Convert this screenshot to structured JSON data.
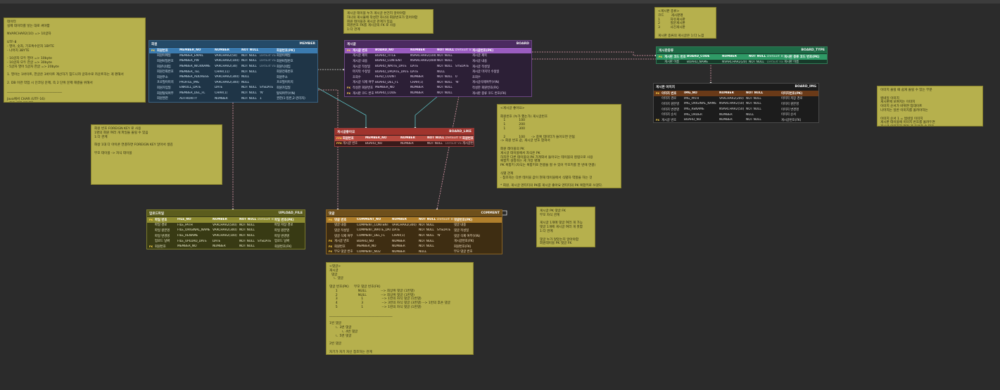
{
  "notes": [
    {
      "id": "note-data-types",
      "lines": [
        "데이터",
        "실제 데이터를 넣는 대로 써야함",
        "",
        "NVARCHAR2(10) => 10글자",
        "",
        "UTF-8",
        "- 영어, 숫자, 기호특수문자 1BYTE",
        "- 나머지 3BYTE",
        "",
        "- 10글자 모두 영어 => 10byte",
        "- 10글자 모두 한글 => 30byte",
        "- 5글자 영어 5글자 한글 => 20byte",
        "",
        "1. 영어는 1바이트, 한글은 3바이트 계산하기 힘드니까 글자수로 카운트하는 게 편해서",
        "",
        "2. DB 이관 작업 시 인코딩 문제, 즉 2 단위 문제 해결을 위해서",
        "",
        "__________________________________",
        "",
        "Java에서 CHAR (UTF-16)",
        "- 모든 글자 2BYTE"
      ]
    },
    {
      "id": "note-fk",
      "lines": [
        "회원 번호 FOREIGN KEY 로 사용",
        "1명의 회원 여러 개 파일을 올릴 수 있음",
        "1:다 관계",
        "",
        "화살 1대 다 아이콘 연결하면 FOREIGN KEY 알아서 생김",
        "",
        "부모 테이블 -> 자식 테이블"
      ]
    },
    {
      "id": "note-board-rel",
      "lines": [
        "게시글 테이블 누가 게시글 쓴건지 알아야함",
        "하나의 게시물에 작성한 하나의 회원번호가 있어야함",
        "회원 테이블과 게시글 관계가 있음",
        "회원번호 FK를 게시글의 FK 로 사용",
        "1:다 관계"
      ]
    },
    {
      "id": "note-board-type",
      "lines": [
        "<게시판 종류>",
        "코드       게시판명",
        "1          자유게시판",
        "2          질문게시판",
        "3          사진게시판",
        "",
        "게시판 종류의 게시글은 1:다 느낌"
      ]
    },
    {
      "id": "note-like",
      "lines": [
        "<게시글 좋아요>",
        "",
        "회원번호 (누가 했는가) 게시글번호",
        "   1             100",
        "   1             200",
        "   1             300",
        "",
        "   2             100      -> 중복 데이터가 들어오면 안됨",
        "-> 회원 번호 값, 게시글 번호 합쳐서",
        "",
        "회원 레이블의 PK",
        "게시글 테이블에서 자식은 PK",
        "하지만 다른 테이블의 PK 가져와서 들어오는 테이블의 컬럼으로 사용",
        "복합키 설정하는 게 가장 명쾌",
        "PK 복합키 (자식는 복합키로 연결을 할 수 있어 부모키를 한 번에 연결)",
        "",
        "식별 관계",
        "- 참조하는 다른 테이블 값이 현재 테이블에서 식별자 역할을 하는 것",
        "",
        "* 회원, 게시글 엔티티의 PK를 게시글 좋아요 엔티티의 PK 복합키로 쓰겠다.",
        "-> (PFK) 식별관계(회)선 업"
      ]
    },
    {
      "id": "note-img",
      "lines": [
        "이미지 올릴 때 쉽게 올릴 수 있는 부분",
        "",
        "썸네일 이미지",
        "게시판에 보여지는 이미지",
        "이미지 순서가 바뀌면 업데이트",
        "나머지는 일반 이미지를 올려야하는",
        "",
        "이미지 순서 1 = 썸네일 이미지",
        "게시판 테이블에 이미지 번호를 올려두면",
        "게시글 이미지가 여러 개 들어갈 수 있음",
        "",
        "게시판 이미지가 게시판 내에 여러 개 가능"
      ]
    },
    {
      "id": "note-comment-fk",
      "lines": [
        "게시글 PK 댓글 FK",
        "부모 자식 관계",
        "",
        "게시글 1개에 댓글 여러 개 가능",
        "댓글 1개에 게시글 여러 개 못함",
        "1:다 관계",
        "",
        "댓글 누가 달았는지 알아야함",
        "회원테이블 PK 댓글 FK"
      ]
    },
    {
      "id": "note-comment-tree",
      "lines": [
        "<댓글>",
        "게시글",
        "  댓글",
        "    ㄴ 댓글",
        "",
        "댓글 번호(PK)     부모 댓글 번호(FK)",
        "      1                    NULL              --> 최상위 댓글 (1번댓)",
        "      2                    NULL              --> 최상위 댓글 (1번댓)",
        "      3                       1                  --> 1번의 자식 댓글 (1번댓)",
        "      4                       3                  --> 3번의 자식 댓글 (3번댓) --> 1번의 후손 댓글",
        "      5                       1                  --> 1번의 자식 댓글 (1번댓)",
        "",
        "_______________________________________",
        "",
        "1번 댓글",
        "      ㄴ 3번 댓글",
        "            ㄴ 4번 댓글",
        "      ㄴ 5번 댓글",
        "",
        "2번 댓글",
        "",
        "자기가 자기 자신 참조하는 관계"
      ]
    }
  ],
  "entities": [
    {
      "id": "member",
      "korean": "회원",
      "english": "MEMBER",
      "rows": [
        [
          "PK",
          "회원번호",
          "MEMBER_NO",
          "NUMBER",
          "NOT NULL",
          "",
          "회원번호(PK)"
        ],
        [
          "",
          "회원이메일",
          "MEMBER_EMAIL",
          "VARCHAR2(50)",
          "NOT NULL",
          "Default Value",
          "회원이메일"
        ],
        [
          "",
          "회원비밀번호",
          "MEMBER_PW",
          "VARCHAR2(100)",
          "NOT NULL",
          "Default Value",
          "회원비밀번호"
        ],
        [
          "",
          "회원닉네임",
          "MEMBER_NICKNAME",
          "VARCHAR2(30)",
          "NOT NULL",
          "Default Value",
          "회원닉네임"
        ],
        [
          "",
          "회원전화번호",
          "MEMBER_TEL",
          "CHAR(11)",
          "NOT NULL",
          "",
          "회원전화번호"
        ],
        [
          "",
          "회원주소",
          "MEMBER_ADDRESS",
          "VARCHAR2(300)",
          "NULL",
          "",
          "회원주소"
        ],
        [
          "",
          "프로필이미지",
          "PROFILE_IMG",
          "VARCHAR2(300)",
          "NULL",
          "",
          "프로필이미지"
        ],
        [
          "",
          "회원가입일",
          "ENROLL_DATE",
          "DATE",
          "NOT NULL",
          "SYSDATE",
          "회원가입일"
        ],
        [
          "",
          "회원탈퇴여부",
          "MEMBER_DEL_FL",
          "CHAR(1)",
          "NOT NULL",
          "'N'",
          "탈퇴여부(Y/N)"
        ],
        [
          "",
          "회원권한",
          "AUTHORITY",
          "NUMBER",
          "NOT NULL",
          "1",
          "권한(1:일반,2:관리자)"
        ]
      ]
    },
    {
      "id": "board",
      "korean": "게시글",
      "english": "BOARD",
      "rows": [
        [
          "PK",
          "게시글 번호",
          "BOARD_NO",
          "NUMBER",
          "NOT NULL",
          "Default Value",
          "게시글번호(PK)"
        ],
        [
          "",
          "게시글 제목",
          "BOARD_TITLE",
          "NVARCHAR2(100)",
          "NOT NULL",
          "",
          "게시글 제목"
        ],
        [
          "",
          "게시글 내용",
          "BOARD_CONTENT",
          "NVARCHAR2(4000)",
          "NOT NULL",
          "",
          "게시글 내용"
        ],
        [
          "",
          "게시글 작성일",
          "BOARD_WRITE_DATE",
          "DATE",
          "NOT NULL",
          "SYSDATE",
          "게시글 작성일"
        ],
        [
          "",
          "마지막 수정일",
          "BOARD_UPDATE_DATE",
          "DATE",
          "NULL",
          "",
          "게시글 마지막 수정일"
        ],
        [
          "",
          "조회수",
          "READ_COUNT",
          "NUMBER",
          "NOT NULL",
          "0",
          "조회수"
        ],
        [
          "",
          "게시글 삭제 여부",
          "BOARD_DEL_FL",
          "CHAR(1)",
          "NOT NULL",
          "'N'",
          "게시글삭제여부(Y/N)"
        ],
        [
          "FK",
          "작성한 회원번호",
          "MEMBER_NO",
          "NUMBER",
          "NOT NULL",
          "",
          "작성한 회원번호(FK)"
        ],
        [
          "FK",
          "게시판 코드 번호",
          "BOARD_CODE",
          "NUMBER",
          "NOT NULL",
          "",
          "게시판 종류 코드 번호(FK)"
        ]
      ]
    },
    {
      "id": "board-type",
      "korean": "게시판종류",
      "english": "BOARD_TYPE",
      "rows": [
        [
          "PK",
          "게시판 코드 번호",
          "BOARD_CODE",
          "NUMBER",
          "NOT NULL",
          "Default Value",
          "게시판 종류 코드 번호(PK)"
        ],
        [
          "",
          "게시판 이름",
          "BOARD_NAME",
          "NVARCHAR2(20)",
          "NOT NULL",
          "Default Value",
          "게시판 이름"
        ]
      ]
    },
    {
      "id": "board-img",
      "korean": "게시판 이미지",
      "english": "BOARD_IMG",
      "rows": [
        [
          "PK",
          "이미지 번호",
          "IMG_NO",
          "NUMBER",
          "NOT NULL",
          "",
          "이미지번호(PK)"
        ],
        [
          "",
          "이미지 경로",
          "IMG_PATH",
          "VARCHAR2(200)",
          "NOT NULL",
          "",
          "이미지 저장 경로"
        ],
        [
          "",
          "이미지 원본명",
          "IMG_ORIGINAL_NAME",
          "NVARCHAR2(50)",
          "NOT NULL",
          "",
          "이미지 원본명"
        ],
        [
          "",
          "이미지 변경명",
          "IMG_RENAME",
          "NVARCHAR2(50)",
          "NOT NULL",
          "",
          "이미지 변경명"
        ],
        [
          "",
          "이미지 순서",
          "IMG_ORDER",
          "NUMBER",
          "NULL",
          "",
          "이미지 순서"
        ],
        [
          "FK",
          "게시글 번호",
          "BOARD_NO",
          "NUMBER",
          "NOT NULL",
          "",
          "게시글번호(FK)"
        ]
      ]
    },
    {
      "id": "board-like",
      "korean": "게시글좋아요",
      "english": "BOARD_LIKE",
      "rows": [
        [
          "PFK",
          "회원번호",
          "MEMBER_NO",
          "NUMBER",
          "NOT NULL",
          "Default Value",
          "회원번호(PFK)"
        ],
        [
          "PFK",
          "게시글 번호",
          "BOARD_NO",
          "NUMBER",
          "NOT NULL",
          "Default Value",
          "게시글번호(PFK)"
        ]
      ]
    },
    {
      "id": "upload-file",
      "korean": "업로드파일",
      "english": "UPLOAD_FILE",
      "rows": [
        [
          "PK",
          "파일 번호",
          "FILE_NO",
          "NUMBER",
          "NOT NULL",
          "Default Value",
          "파일 번호(PK)"
        ],
        [
          "",
          "파일 경로",
          "FILE_PATH",
          "VARCHAR2(500)",
          "NOT NULL",
          "",
          "파일 저장 경로"
        ],
        [
          "",
          "파일 원본명",
          "FILE_ORIGINAL_NAME",
          "VARCHAR2(300)",
          "NOT NULL",
          "",
          "파일 원본명"
        ],
        [
          "",
          "파일 변경명",
          "FILE_RENAME",
          "VARCHAR2(100)",
          "NOT NULL",
          "",
          "파일 변경명"
        ],
        [
          "",
          "업로드 날짜",
          "FILE_UPLOAD_DATE",
          "DATE",
          "NOT NULL",
          "SYSDATE",
          "업로드 날짜"
        ],
        [
          "FK",
          "회원번호",
          "MEMBER_NO",
          "NUMBER",
          "NOT NULL",
          "",
          "회원번호(FK)"
        ]
      ]
    },
    {
      "id": "comment",
      "korean": "댓글",
      "english": "COMMENT",
      "rows": [
        [
          "PK",
          "댓글 번호",
          "COMMENT_NO",
          "NUMBER",
          "NOT NULL",
          "Default Value",
          "댓글번호(PK)"
        ],
        [
          "",
          "댓글 내용",
          "COMMENT_CONTENT",
          "VARCHAR2(300)",
          "NOT NULL",
          "",
          "댓글 내용"
        ],
        [
          "",
          "댓글 작성일",
          "COMMENT_WRITE_DATE",
          "DATE",
          "NOT NULL",
          "SYSDATE",
          "댓글 작성일"
        ],
        [
          "",
          "댓글 삭제 여부",
          "COMMENT_DEL_FL",
          "CHAR(1)",
          "NOT NULL",
          "'N'",
          "댓글 삭제 여부(Y/N)"
        ],
        [
          "FK",
          "게시글 번호",
          "BOARD_NO",
          "NUMBER",
          "NOT NULL",
          "",
          "게시글번호(FK)"
        ],
        [
          "FK",
          "회원번호",
          "MEMBER_NO",
          "NUMBER",
          "NOT NULL",
          "",
          "회원번호(FK)"
        ],
        [
          "FK",
          "부모 댓글 번호",
          "COMMENT_NO2",
          "NUMBER",
          "NULL",
          "",
          "부모 댓글 번호"
        ]
      ]
    }
  ],
  "colors": {
    "canvas": "#2b2b2b",
    "note": "#b6b04d",
    "connector_pink": "#e6a0b0",
    "connector_teal": "#5fc3c8"
  }
}
